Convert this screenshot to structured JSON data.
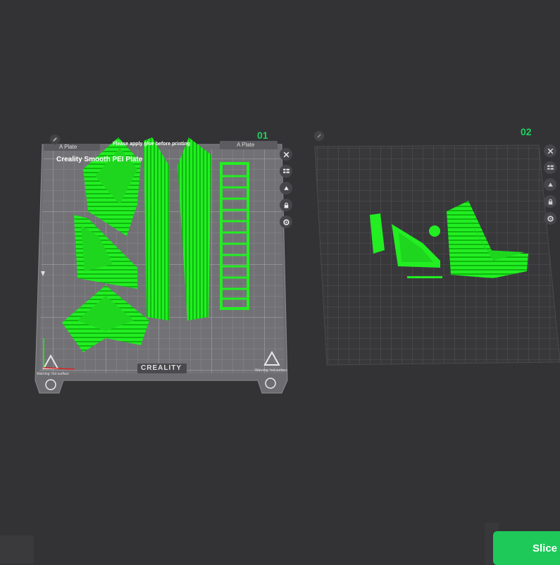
{
  "plates": [
    {
      "number": "01",
      "tabs": [
        "A Plate",
        "A Plate"
      ],
      "title": "Creality Smooth PEI Plate",
      "notice": "Please apply glue before printing",
      "brand": "CREALITY",
      "warning": "Warning: hot surface"
    },
    {
      "number": "02"
    }
  ],
  "slice_button": {
    "label": "Slice"
  },
  "colors": {
    "background": "#333335",
    "model": "#22ee22",
    "accent": "#1ec95a",
    "plate_bed": "#6e6e72",
    "grid": "#8a8a8e"
  },
  "icons": {
    "plate1_tools": [
      "close-icon",
      "arrange-icon",
      "orient-icon",
      "lock-icon",
      "settings-icon"
    ],
    "plate2_tools": [
      "close-icon",
      "arrange-icon",
      "orient-icon",
      "lock-icon",
      "settings-icon"
    ]
  }
}
